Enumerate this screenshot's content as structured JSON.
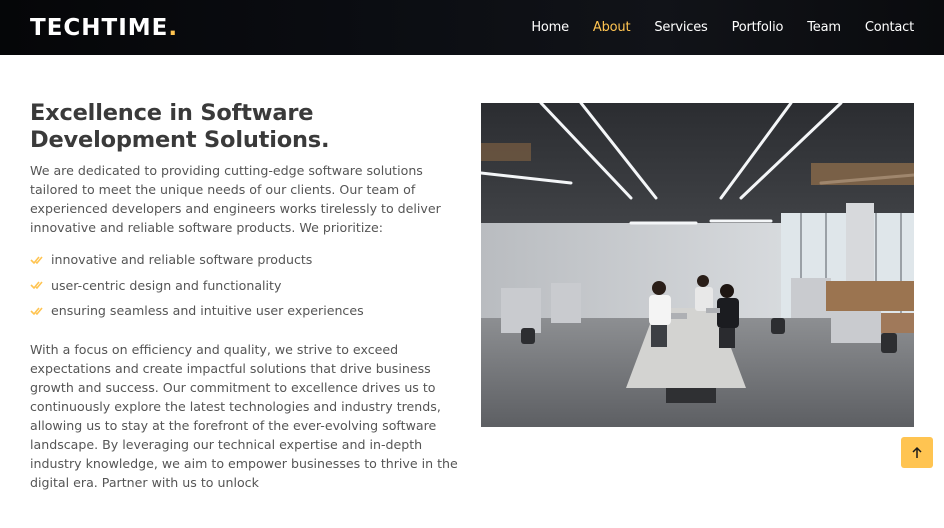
{
  "header": {
    "logo_text": "TECHTIME",
    "logo_dot": ".",
    "nav": [
      "Home",
      "About",
      "Services",
      "Portfolio",
      "Team",
      "Contact"
    ],
    "active_nav": "About"
  },
  "about": {
    "title": "Excellence in Software Development Solutions.",
    "intro": "We are dedicated to providing cutting-edge software solutions tailored to meet the unique needs of our clients. Our team of experienced developers and engineers works tirelessly to deliver innovative and reliable software products. We prioritize:",
    "points": [
      "innovative and reliable software products",
      "user-centric design and functionality",
      "ensuring seamless and intuitive user experiences"
    ],
    "body": "With a focus on efficiency and quality, we strive to exceed expectations and create impactful solutions that drive business growth and success. Our commitment to excellence drives us to continuously explore the latest technologies and industry trends, allowing us to stay at the forefront of the ever-evolving software landscape. By leveraging our technical expertise and in-depth industry knowledge, we aim to empower businesses to thrive in the digital era. Partner with us to unlock"
  },
  "icons": {
    "check": "double-check-icon",
    "back_to_top": "arrow-up-icon"
  },
  "colors": {
    "accent": "#ffc451",
    "header_bg": "#0b0d12",
    "heading": "#3a3a3a",
    "text": "#555555"
  }
}
